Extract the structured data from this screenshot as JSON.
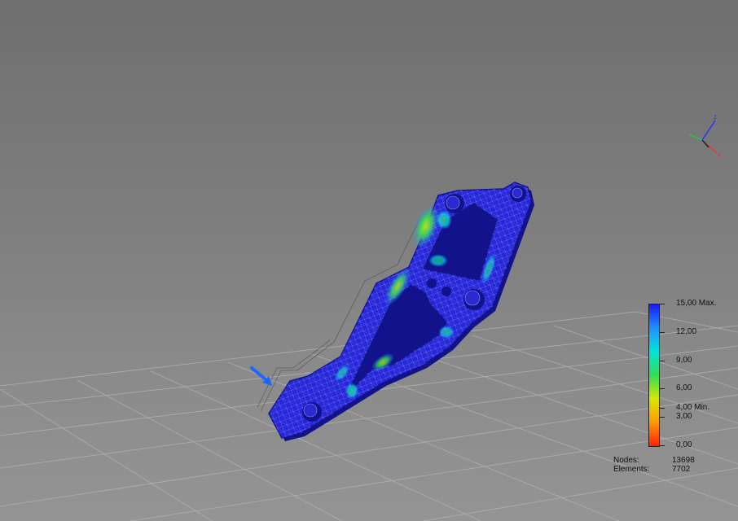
{
  "legend": {
    "ticks": [
      {
        "value": 15.0,
        "label": "15,00 Max."
      },
      {
        "value": 12.0,
        "label": "12,00"
      },
      {
        "value": 9.0,
        "label": "9,00"
      },
      {
        "value": 6.0,
        "label": "6,00"
      },
      {
        "value": 4.0,
        "label": "4,00 Min."
      },
      {
        "value": 3.0,
        "label": "3,00"
      },
      {
        "value": 0.0,
        "label": "0,00"
      }
    ],
    "range": [
      0,
      15
    ],
    "colors": [
      "#1a1aff",
      "#1e90ff",
      "#00e5d8",
      "#33dd55",
      "#d8e800",
      "#ff9900",
      "#ff2200"
    ]
  },
  "stats": {
    "nodes_label": "Nodes:",
    "nodes_value": "13698",
    "elements_label": "Elements:",
    "elements_value": "7702"
  },
  "colors": {
    "part_base": "#2727d8",
    "part_edge": "#12128a",
    "mesh_line": "#9aa4ff",
    "load_arrow": "#1e66ff"
  },
  "icons": {
    "triad": "axis-triad-icon",
    "load": "load-arrow-icon"
  }
}
